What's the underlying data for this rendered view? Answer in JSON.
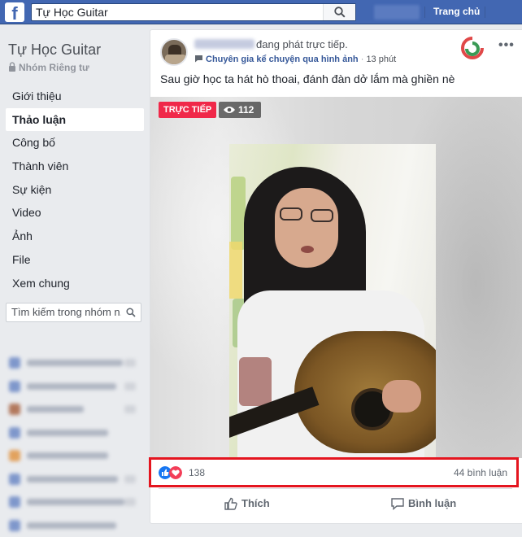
{
  "topbar": {
    "search_value": "Tự Học Guitar",
    "home_label": "Trang chủ"
  },
  "sidebar": {
    "group_name": "Tự Học Guitar",
    "privacy": "Nhóm Riêng tư",
    "items": [
      {
        "label": "Giới thiệu"
      },
      {
        "label": "Thảo luận",
        "active": true
      },
      {
        "label": "Công bố"
      },
      {
        "label": "Thành viên"
      },
      {
        "label": "Sự kiện"
      },
      {
        "label": "Video"
      },
      {
        "label": "Ảnh"
      },
      {
        "label": "File"
      },
      {
        "label": "Xem chung"
      }
    ],
    "search_placeholder": "Tìm kiếm trong nhóm n..."
  },
  "post": {
    "live_action": "đang phát trực tiếp.",
    "app_name": "Chuyên gia kể chuyện qua hình ảnh",
    "separator": "·",
    "time": "13 phút",
    "caption": "Sau giờ học ta hát hò thoai, đánh đàn dở lắm mà ghiền nè",
    "live_badge": "TRỰC TIẾP",
    "viewer_count": "112",
    "reaction_count": "138",
    "comment_count": "44 bình luận",
    "like_label": "Thích",
    "comment_label": "Bình luận",
    "more_label": "•••"
  },
  "colors": {
    "topbar": "#4267b2",
    "live_red": "#f02849",
    "highlight_border": "#e4151f",
    "like_blue": "#1877f2",
    "love_red": "#f33e58"
  }
}
